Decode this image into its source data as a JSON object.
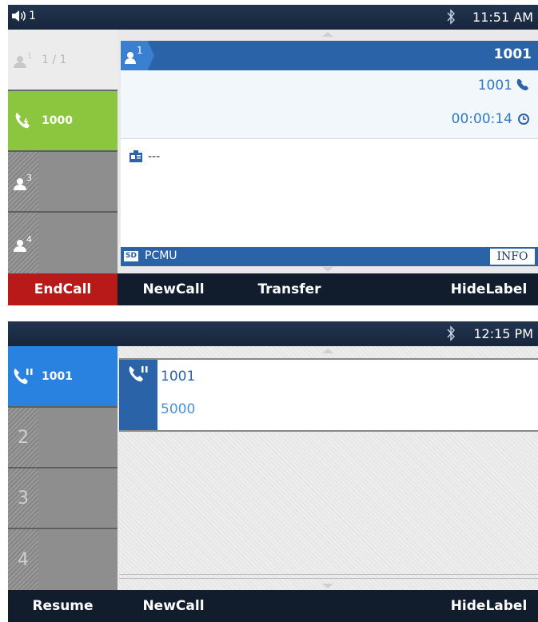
{
  "screen1": {
    "status": {
      "volume_label": "1",
      "time": "11:51 AM"
    },
    "lines": [
      {
        "label": "1 / 1",
        "badge": "1",
        "state": "conference"
      },
      {
        "label": "1000",
        "state": "active"
      },
      {
        "label": "",
        "badge": "3",
        "state": "idle"
      },
      {
        "label": "",
        "badge": "4",
        "state": "idle"
      }
    ],
    "call": {
      "badge": "1",
      "remote_number": "1001",
      "local_number": "1001",
      "duration": "00:00:14",
      "note": "---",
      "codec_badge": "SD",
      "codec": "PCMU",
      "info_button": "INFO"
    },
    "softkeys": [
      "EndCall",
      "NewCall",
      "Transfer",
      "HideLabel"
    ]
  },
  "screen2": {
    "status": {
      "time": "12:15 PM"
    },
    "lines": [
      {
        "label": "1001",
        "state": "hold"
      },
      {
        "label": "",
        "index": "2",
        "state": "idle"
      },
      {
        "label": "",
        "index": "3",
        "state": "idle"
      },
      {
        "label": "",
        "index": "4",
        "state": "idle"
      }
    ],
    "call": {
      "name": "1001",
      "number": "5000"
    },
    "softkeys": [
      "Resume",
      "NewCall",
      "HideLabel"
    ]
  },
  "colors": {
    "accent_blue": "#2b63a8",
    "active_green": "#8cc63f",
    "end_red": "#b81a1a",
    "hold_blue": "#2a82e0",
    "text_blue": "#2f7ac7"
  }
}
